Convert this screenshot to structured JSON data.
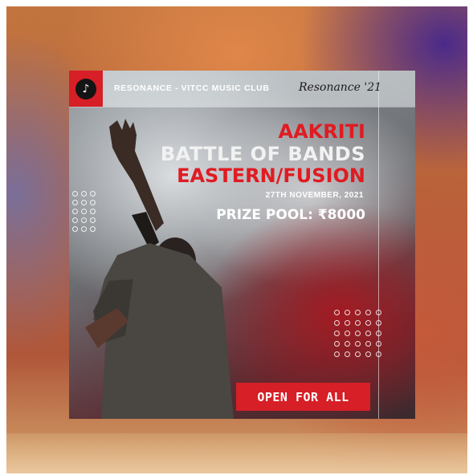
{
  "poster": {
    "club_name": "RESONANCE - VITCC MUSIC CLUB",
    "brand_script": "Resonance '21",
    "title_line1": "AAKRITI",
    "title_line2": "BATTLE OF BANDS",
    "title_line3": "EASTERN/FUSION",
    "date": "27TH NOVEMBER, 2021",
    "prize": "PRIZE POOL: ₹8000",
    "cta_label": "OPEN FOR ALL",
    "logo_glyph": "♪"
  },
  "colors": {
    "accent_red": "#d61f26",
    "title_white": "#f2f2f2"
  },
  "icons": {
    "logo": "music-note-icon"
  }
}
